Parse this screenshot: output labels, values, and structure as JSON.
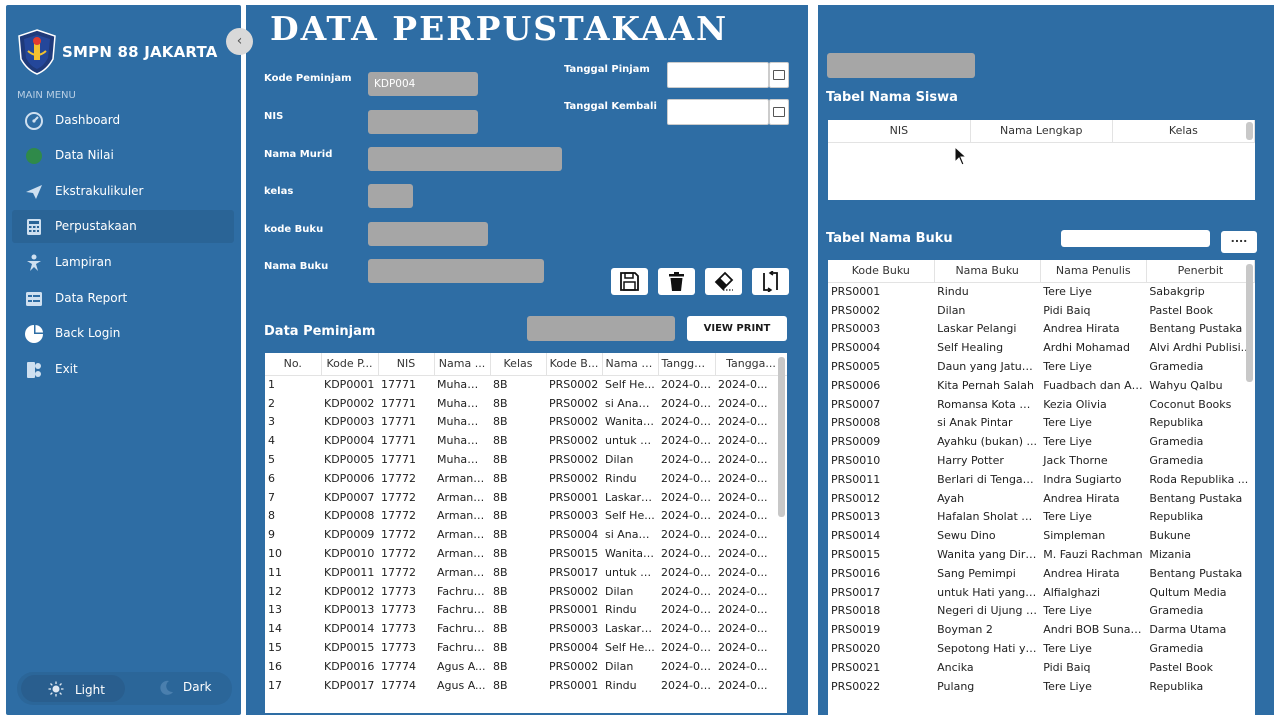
{
  "sidebar": {
    "school_name": "SMPN 88 JAKARTA",
    "menu_heading": "MAIN MENU",
    "items": [
      {
        "label": "Dashboard",
        "icon": "speedometer-icon"
      },
      {
        "label": "Data Nilai",
        "icon": "circle-icon"
      },
      {
        "label": "Ekstrakulikuler",
        "icon": "paper-plane-icon"
      },
      {
        "label": "Perpustakaan",
        "icon": "calculator-icon"
      },
      {
        "label": "Lampiran",
        "icon": "person-star-icon"
      },
      {
        "label": "Data Report",
        "icon": "report-icon"
      },
      {
        "label": "Back Login",
        "icon": "pie-icon"
      },
      {
        "label": "Exit",
        "icon": "exit-icon"
      }
    ],
    "active_item": "Perpustakaan",
    "theme": {
      "light": "Light",
      "dark": "Dark"
    }
  },
  "main": {
    "title": "DATA PERPUSTAKAAN",
    "form": {
      "kode_peminjam_label": "Kode Peminjam",
      "kode_peminjam_value": "KDP004",
      "nis_label": "NIS",
      "nama_murid_label": "Nama Murid",
      "kelas_label": "kelas",
      "kode_buku_label": "kode Buku",
      "nama_buku_label": "Nama Buku",
      "tanggal_pinjam_label": "Tanggal Pinjam",
      "tanggal_kembali_label": "Tanggal Kembali"
    },
    "data_peminjam_label": "Data Peminjam",
    "view_print_label": "VIEW PRINT",
    "peminjam_table": {
      "columns": [
        "No.",
        "Kode P...",
        "NIS",
        "Nama ...",
        "Kelas",
        "Kode B...",
        "Nama B...",
        "Tanggal...",
        "Tangga..."
      ],
      "rows": [
        [
          "1",
          "KDP0001",
          "17771",
          "Muham...",
          "8B",
          "PRS0002",
          "Self He...",
          "2024-01...",
          "2024-0..."
        ],
        [
          "2",
          "KDP0002",
          "17771",
          "Muham...",
          "8B",
          "PRS0002",
          "si Anak ...",
          "2024-01...",
          "2024-0..."
        ],
        [
          "3",
          "KDP0003",
          "17771",
          "Muham...",
          "8B",
          "PRS0002",
          "Wanita ...",
          "2024-01...",
          "2024-0..."
        ],
        [
          "4",
          "KDP0004",
          "17771",
          "Muham...",
          "8B",
          "PRS0002",
          "untuk H...",
          "2024-01...",
          "2024-0..."
        ],
        [
          "5",
          "KDP0005",
          "17771",
          "Muham...",
          "8B",
          "PRS0002",
          "Dilan",
          "2024-01...",
          "2024-0..."
        ],
        [
          "6",
          "KDP0006",
          "17772",
          "Arman ...",
          "8B",
          "PRS0002",
          "Rindu",
          "2024-05...",
          "2024-0..."
        ],
        [
          "7",
          "KDP0007",
          "17772",
          "Arman ...",
          "8B",
          "PRS0001",
          "Laskar ...",
          "2024-05...",
          "2024-0..."
        ],
        [
          "8",
          "KDP0008",
          "17772",
          "Arman ...",
          "8B",
          "PRS0003",
          "Self He...",
          "2024-05...",
          "2024-0..."
        ],
        [
          "9",
          "KDP0009",
          "17772",
          "Arman ...",
          "8B",
          "PRS0004",
          "si Anak ...",
          "2024-05...",
          "2024-0..."
        ],
        [
          "10",
          "KDP0010",
          "17772",
          "Arman ...",
          "8B",
          "PRS0015",
          "Wanita ...",
          "2024-05...",
          "2024-0..."
        ],
        [
          "11",
          "KDP0011",
          "17772",
          "Arman ...",
          "8B",
          "PRS0017",
          "untuk H...",
          "2024-05...",
          "2024-0..."
        ],
        [
          "12",
          "KDP0012",
          "17773",
          "Fachrul ...",
          "8B",
          "PRS0002",
          "Dilan",
          "2024-05...",
          "2024-0..."
        ],
        [
          "13",
          "KDP0013",
          "17773",
          "Fachrul ...",
          "8B",
          "PRS0001",
          "Rindu",
          "2024-05...",
          "2024-0..."
        ],
        [
          "14",
          "KDP0014",
          "17773",
          "Fachrul ...",
          "8B",
          "PRS0003",
          "Laskar ...",
          "2024-05...",
          "2024-0..."
        ],
        [
          "15",
          "KDP0015",
          "17773",
          "Fachrul ...",
          "8B",
          "PRS0004",
          "Self He...",
          "2024-05...",
          "2024-0..."
        ],
        [
          "16",
          "KDP0016",
          "17774",
          "Agus A...",
          "8B",
          "PRS0002",
          "Dilan",
          "2024-05...",
          "2024-0..."
        ],
        [
          "17",
          "KDP0017",
          "17774",
          "Agus A...",
          "8B",
          "PRS0001",
          "Rindu",
          "2024-05...",
          "2024-0..."
        ]
      ]
    }
  },
  "right": {
    "tabel_siswa_label": "Tabel Nama Siswa",
    "siswa_columns": [
      "NIS",
      "Nama Lengkap",
      "Kelas"
    ],
    "tabel_buku_label": "Tabel Nama Buku",
    "search_button_label": "....",
    "buku_columns": [
      "Kode Buku",
      "Nama Buku",
      "Nama Penulis",
      "Penerbit"
    ],
    "buku_rows": [
      [
        "PRS0001",
        "Rindu",
        "Tere Liye",
        "Sabakgrip"
      ],
      [
        "PRS0002",
        "Dilan",
        "Pidi Baiq",
        "Pastel Book"
      ],
      [
        "PRS0003",
        "Laskar Pelangi",
        "Andrea Hirata",
        "Bentang Pustaka"
      ],
      [
        "PRS0004",
        "Self Healing",
        "Ardhi Mohamad",
        "Alvi Ardhi Publisi..."
      ],
      [
        "PRS0005",
        "Daun yang Jatuh...",
        "Tere Liye",
        "Gramedia"
      ],
      [
        "PRS0006",
        "Kita Pernah Salah",
        "Fuadbach dan Ar...",
        "Wahyu Qalbu"
      ],
      [
        "PRS0007",
        "Romansa Kota B...",
        "Kezia Olivia",
        "Coconut Books"
      ],
      [
        "PRS0008",
        "si Anak Pintar",
        "Tere Liye",
        "Republika"
      ],
      [
        "PRS0009",
        "Ayahku (bukan) ...",
        "Tere Liye",
        "Gramedia"
      ],
      [
        "PRS0010",
        "Harry Potter",
        "Jack Thorne",
        "Gramedia"
      ],
      [
        "PRS0011",
        "Berlari di Tengah...",
        "Indra Sugiarto",
        "Roda Republika ..."
      ],
      [
        "PRS0012",
        "Ayah",
        "Andrea Hirata",
        "Bentang Pustaka"
      ],
      [
        "PRS0013",
        "Hafalan Sholat D...",
        "Tere Liye",
        "Republika"
      ],
      [
        "PRS0014",
        "Sewu Dino",
        "Simpleman",
        "Bukune"
      ],
      [
        "PRS0015",
        "Wanita yang Diri...",
        "M. Fauzi Rachman",
        "Mizania"
      ],
      [
        "PRS0016",
        "Sang Pemimpi",
        "Andrea Hirata",
        "Bentang Pustaka"
      ],
      [
        "PRS0017",
        "untuk Hati yang ...",
        "Alfialghazi",
        "Qultum Media"
      ],
      [
        "PRS0018",
        "Negeri di Ujung T...",
        "Tere Liye",
        "Gramedia"
      ],
      [
        "PRS0019",
        "Boyman 2",
        "Andri BOB Sunardi",
        "Darma Utama"
      ],
      [
        "PRS0020",
        "Sepotong Hati ya...",
        "Tere Liye",
        "Gramedia"
      ],
      [
        "PRS0021",
        "Ancika",
        "Pidi Baiq",
        "Pastel Book"
      ],
      [
        "PRS0022",
        "Pulang",
        "Tere Liye",
        "Republika"
      ]
    ]
  },
  "colors": {
    "panel": "#2e6da4",
    "active_menu": "#2a6496",
    "field_gray": "#a6a6a6"
  }
}
